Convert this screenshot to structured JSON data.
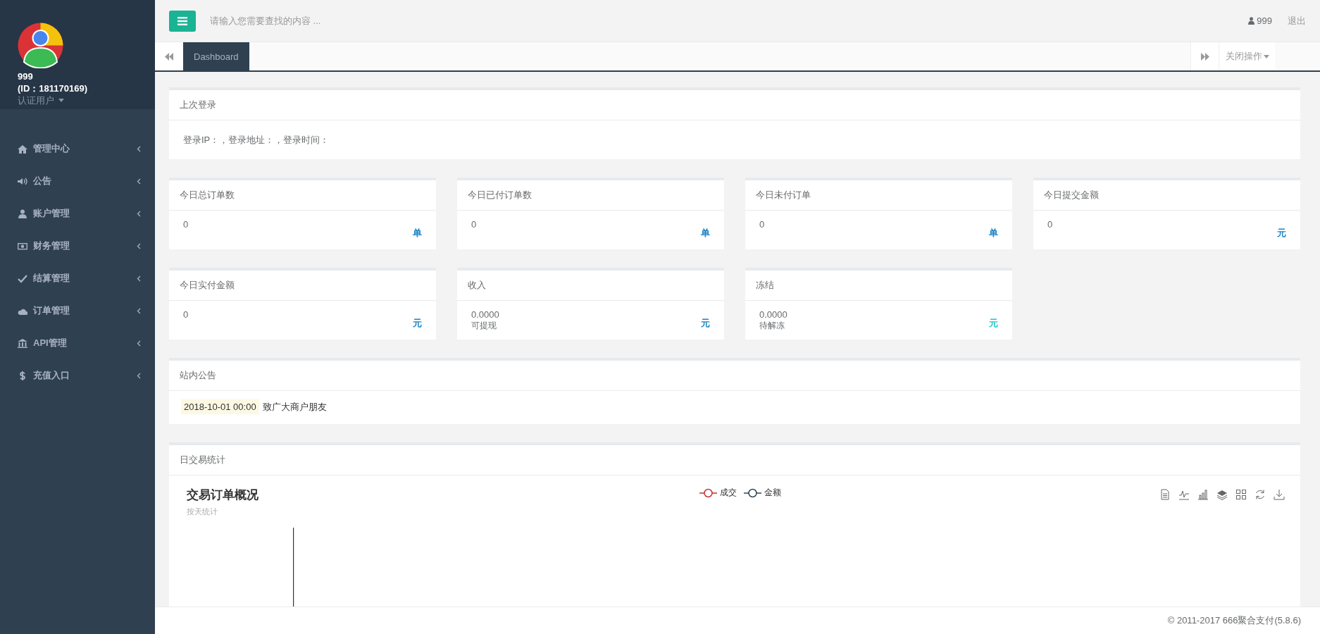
{
  "sidebar": {
    "user": {
      "name": "999",
      "id": "(ID：181170169)",
      "role": "认证用户"
    },
    "items": [
      {
        "label": "管理中心"
      },
      {
        "label": "公告"
      },
      {
        "label": "账户管理"
      },
      {
        "label": "财务管理"
      },
      {
        "label": "结算管理"
      },
      {
        "label": "订单管理"
      },
      {
        "label": "API管理"
      },
      {
        "label": "充值入口"
      }
    ]
  },
  "topbar": {
    "search": {
      "placeholder": "请输入您需要查找的内容 ..."
    },
    "user": "999",
    "logout": "退出"
  },
  "tabs": [
    {
      "label": "Dashboard",
      "selected": true
    }
  ],
  "tab_actions": {
    "close_menu": "关闭操作"
  },
  "last_login": {
    "title": "上次登录",
    "text": "登录IP：，登录地址：，登录时间："
  },
  "stats": [
    {
      "title": "今日总订单数",
      "value": "0",
      "unit": "单",
      "color": "#1c84c6"
    },
    {
      "title": "今日已付订单数",
      "value": "0",
      "unit": "单",
      "color": "#1c84c6"
    },
    {
      "title": "今日未付订单",
      "value": "0",
      "unit": "单",
      "color": "#1c84c6"
    },
    {
      "title": "今日提交金额",
      "value": "0",
      "unit": "元",
      "color": "#1c84c6"
    },
    {
      "title": "今日实付金额",
      "value": "0",
      "unit": "元",
      "color": "#1c84c6"
    },
    {
      "title": "收入",
      "value": "0.0000",
      "note": "可提现",
      "unit": "元",
      "color": "#1c84c6"
    },
    {
      "title": "冻结",
      "value": "0.0000",
      "note": "待解冻",
      "unit": "元",
      "color": "#23c6c8"
    }
  ],
  "announcements": {
    "title": "站内公告",
    "items": [
      {
        "date": "2018-10-01 00:00",
        "text": "致广大商户朋友"
      }
    ]
  },
  "daily_stats": {
    "title": "日交易统计",
    "chart": {
      "title": "交易订单概况",
      "subtitle": "按天统计",
      "legend": [
        {
          "name": "成交",
          "color": "#c23531"
        },
        {
          "name": "金额",
          "color": "#2f4554"
        }
      ]
    }
  },
  "footer": "© 2011-2017 666聚合支付(5.8.6)"
}
